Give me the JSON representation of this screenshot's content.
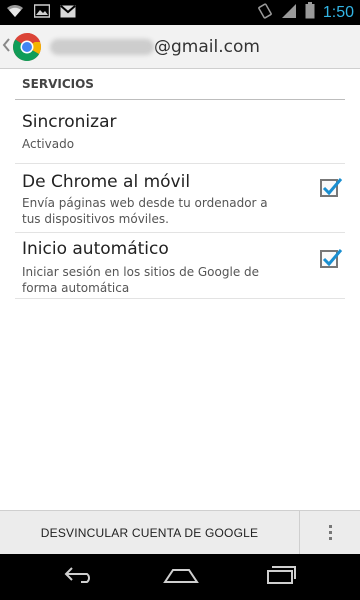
{
  "status_bar": {
    "time": "1:50",
    "icons": [
      "wifi-icon",
      "image-icon",
      "gmail-icon",
      "rotation-icon",
      "signal-icon",
      "battery-icon"
    ]
  },
  "header": {
    "account_redacted": "practicoemilio",
    "account_domain": "@gmail.com",
    "icons": [
      "back-chevron-icon",
      "chrome-icon"
    ]
  },
  "services": {
    "section_title": "SERVICIOS",
    "items": [
      {
        "title": "Sincronizar",
        "subtitle": "Activado",
        "checked": null
      },
      {
        "title": "De Chrome al móvil",
        "subtitle": "Envía páginas web desde tu ordenador a tus dispositivos móviles.",
        "checked": true
      },
      {
        "title": "Inicio automático",
        "subtitle": "Iniciar sesión en los sitios de Google de forma automática",
        "checked": true
      }
    ]
  },
  "footer": {
    "unlink_label": "DESVINCULAR CUENTA DE GOOGLE",
    "overflow_icon": "overflow-menu-icon"
  },
  "nav": {
    "icons": [
      "back-icon",
      "home-icon",
      "recents-icon"
    ]
  },
  "colors": {
    "accent": "#33b5e5",
    "check_blue": "#1a8fd1"
  }
}
